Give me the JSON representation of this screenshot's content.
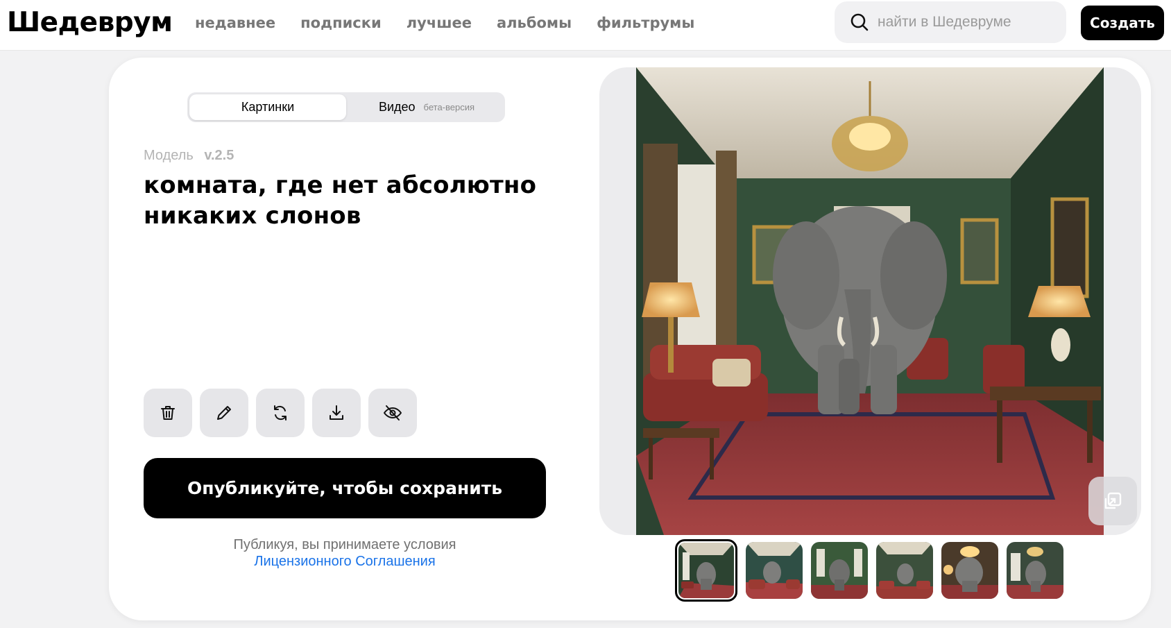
{
  "brand": {
    "logo": "Шедеврум"
  },
  "nav": {
    "items": [
      {
        "label": "недавнее"
      },
      {
        "label": "подписки"
      },
      {
        "label": "лучшее"
      },
      {
        "label": "альбомы"
      },
      {
        "label": "фильтрумы"
      }
    ]
  },
  "search": {
    "placeholder": "найти в Шедевруме",
    "icon": "search-icon"
  },
  "header": {
    "create_label": "Создать"
  },
  "mode": {
    "tabs": [
      {
        "label": "Картинки",
        "active": true
      },
      {
        "label": "Видео",
        "badge": "бета-версия"
      }
    ]
  },
  "model": {
    "label": "Модель",
    "version": "v.2.5"
  },
  "prompt": {
    "text": "комната, где нет абсолютно никаких слонов"
  },
  "actions": [
    {
      "icon": "trash-icon"
    },
    {
      "icon": "pencil-icon"
    },
    {
      "icon": "regenerate-icon"
    },
    {
      "icon": "download-icon"
    },
    {
      "icon": "hide-eye-icon"
    }
  ],
  "publish": {
    "label": "Опубликуйте, чтобы сохранить"
  },
  "license": {
    "text": "Публикуя, вы принимаете условия",
    "link": "Лицензионного Соглашения"
  },
  "gallery": {
    "selected_index": 0,
    "thumbnail_count": 6
  },
  "colors": {
    "accent": "#000000",
    "link": "#1a73e8",
    "wall_green": "#2f4a35",
    "carpet_red": "#8e3434"
  }
}
